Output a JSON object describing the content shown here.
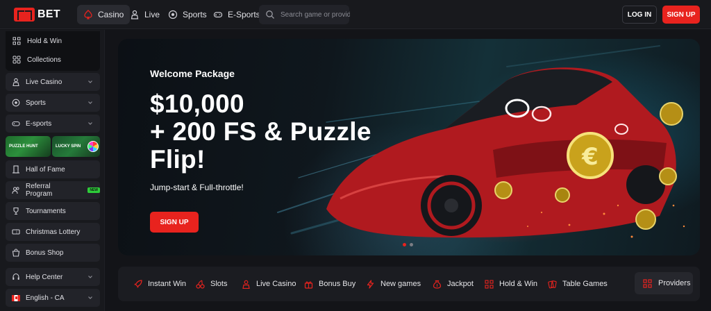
{
  "brand": {
    "logo_text": "BET",
    "accent": "#e8231e"
  },
  "header": {
    "nav": [
      {
        "label": "Casino",
        "icon": "spade-icon",
        "active": true
      },
      {
        "label": "Live",
        "icon": "dealer-icon",
        "active": false
      },
      {
        "label": "Sports",
        "icon": "soccer-ball-icon",
        "active": false
      },
      {
        "label": "E-Sports",
        "icon": "gamepad-icon",
        "active": false
      }
    ],
    "search_placeholder": "Search game or provider",
    "login_label": "LOG IN",
    "signup_label": "SIGN UP"
  },
  "sidebar": {
    "sub_items": [
      {
        "label": "Hold & Win",
        "icon": "grid-dots-icon"
      },
      {
        "label": "Collections",
        "icon": "collections-icon"
      }
    ],
    "items": [
      {
        "label": "Live Casino",
        "icon": "dealer-icon",
        "expandable": true
      },
      {
        "label": "Sports",
        "icon": "soccer-ball-icon",
        "expandable": true
      },
      {
        "label": "E-sports",
        "icon": "gamepad-icon",
        "expandable": true
      },
      {
        "label": "Hall of Fame",
        "icon": "hall-icon"
      },
      {
        "label": "Referral Program",
        "icon": "users-icon",
        "badge": "NEW"
      },
      {
        "label": "Tournaments",
        "icon": "trophy-icon"
      },
      {
        "label": "Christmas Lottery",
        "icon": "ticket-icon"
      },
      {
        "label": "Bonus Shop",
        "icon": "shop-icon"
      },
      {
        "label": "Help Center",
        "icon": "headset-icon",
        "expandable": true
      },
      {
        "label": "English - CA",
        "icon": "canada-flag-icon",
        "expandable": true
      }
    ],
    "promos": [
      {
        "label": "PUZZLE HUNT"
      },
      {
        "label": "LUCKY SPIN"
      }
    ]
  },
  "hero": {
    "label": "Welcome Package",
    "title_line1": "$10,000",
    "title_line2": "+ 200 FS & Puzzle",
    "title_line3": "Flip!",
    "subtitle": "Jump-start & Full-throttle!",
    "cta_label": "SIGN UP",
    "slides_total": 2,
    "active_slide": 1
  },
  "categories": {
    "items": [
      {
        "label": "Instant Win",
        "icon": "rocket-icon"
      },
      {
        "label": "Slots",
        "icon": "cherries-icon"
      },
      {
        "label": "Live Casino",
        "icon": "dealer-icon"
      },
      {
        "label": "Bonus Buy",
        "icon": "bonus-buy-icon"
      },
      {
        "label": "New games",
        "icon": "lightning-icon"
      },
      {
        "label": "Jackpot",
        "icon": "money-bag-icon"
      },
      {
        "label": "Hold & Win",
        "icon": "grid-dots-icon"
      },
      {
        "label": "Table Games",
        "icon": "cards-icon"
      }
    ],
    "providers_label": "Providers"
  }
}
